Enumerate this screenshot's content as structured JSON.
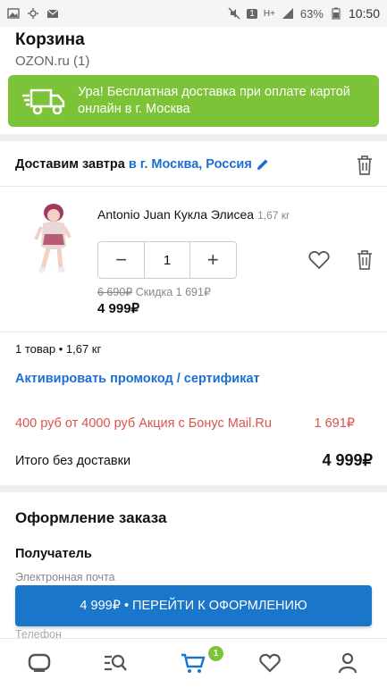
{
  "statusbar": {
    "battery": "63%",
    "time": "10:50",
    "sim_badge": "1",
    "network": "H+"
  },
  "header": {
    "title": "Корзина",
    "subtitle": "OZON.ru (1)"
  },
  "banner": {
    "text_line1": "Ура! Бесплатная доставка при оплате картой",
    "text_line2": "онлайн в г. Москва",
    "color": "#7cc338"
  },
  "delivery": {
    "label": "Доставим завтра",
    "city": "в г. Москва, Россия"
  },
  "product": {
    "name": "Antonio Juan Кукла Элисеа",
    "weight": "1,67 кг",
    "quantity": "1",
    "minus": "−",
    "plus": "+",
    "old_price": "6 690₽",
    "discount": "Скидка 1 691₽",
    "price": "4 999₽"
  },
  "summary": {
    "items": "1 товар • 1,67 кг",
    "promo_link": "Активировать промокод / сертификат",
    "promo_text": "400 руб от 4000 руб Акция с Бонус Mail.Ru",
    "promo_amount": "1 691₽",
    "total_label": "Итого без доставки",
    "total_value": "4 999₽"
  },
  "checkout": {
    "title": "Оформление заказа",
    "recipient": "Получатель",
    "email_label": "Электронная почта",
    "phone_label": "Телефон",
    "cta_label": "4 999₽ • ПЕРЕЙТИ К ОФОРМЛЕНИЮ"
  },
  "bottomnav": {
    "items": [
      "home-icon",
      "catalog-search-icon",
      "cart-icon",
      "favorites-icon",
      "profile-icon"
    ],
    "cart_badge": "1",
    "accent": "#1976c9"
  }
}
